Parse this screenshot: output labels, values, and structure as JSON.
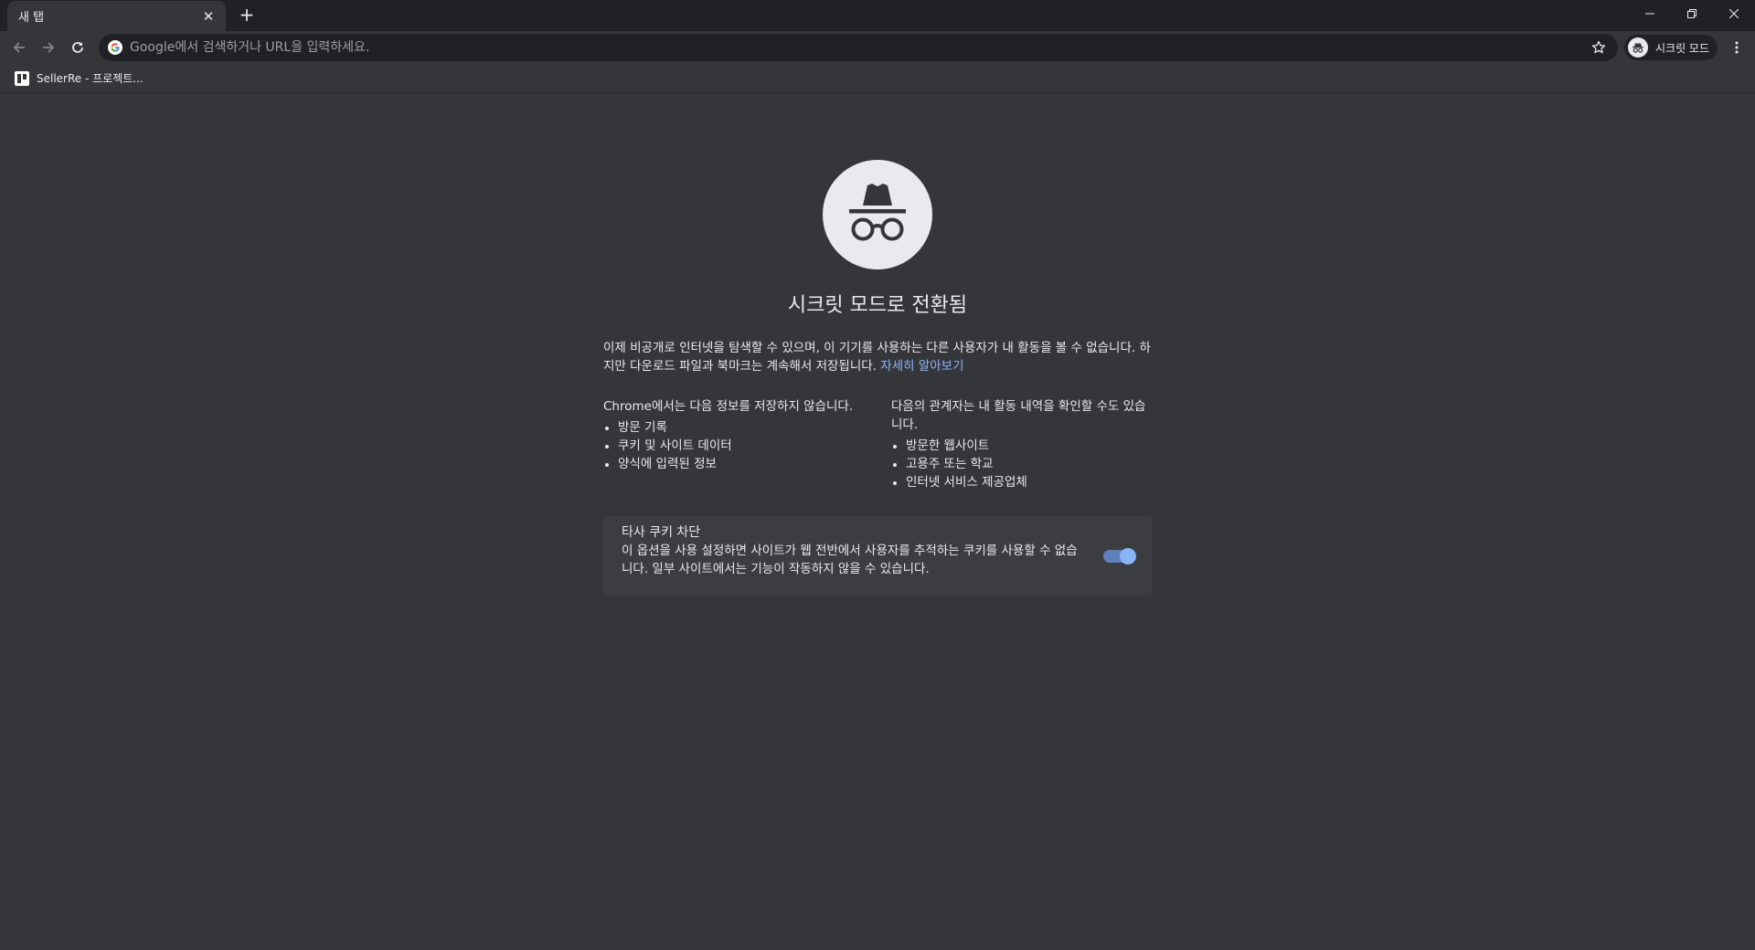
{
  "tab": {
    "title": "새 탭",
    "close_glyph": "✕"
  },
  "new_tab_glyph": "+",
  "omnibox": {
    "placeholder": "Google에서 검색하거나 URL을 입력하세요."
  },
  "profile": {
    "label": "시크릿 모드"
  },
  "bookmarks": [
    {
      "label": "SellerRe - 프로젝트..."
    }
  ],
  "content": {
    "title": "시크릿 모드로 전환됨",
    "intro": "이제 비공개로 인터넷을 탐색할 수 있으며, 이 기기를 사용하는 다른 사용자가 내 활동을 볼 수 없습니다. 하지만 다운로드 파일과 북마크는 계속해서 저장됩니다. ",
    "learn_more": "자세히 알아보기",
    "not_saved": {
      "heading": "Chrome에서는 다음 정보를 저장하지 않습니다.",
      "items": [
        "방문 기록",
        "쿠키 및 사이트 데이터",
        "양식에 입력된 정보"
      ]
    },
    "visible_to": {
      "heading": "다음의 관계자는 내 활동 내역을 확인할 수도 있습니다.",
      "items": [
        "방문한 웹사이트",
        "고용주 또는 학교",
        "인터넷 서비스 제공업체"
      ]
    },
    "cookie_card": {
      "title": "타사 쿠키 차단",
      "description": "이 옵션을 사용 설정하면 사이트가 웹 전반에서 사용자를 추적하는 쿠키를 사용할 수 없습니다. 일부 사이트에서는 기능이 작동하지 않을 수 있습니다.",
      "toggle_on": true
    }
  },
  "colors": {
    "background": "#35363a",
    "tabstrip": "#202124",
    "link": "#8ab4f8",
    "toggle_track": "#5e7fbd",
    "toggle_knob": "#8ab4f8"
  },
  "icons": [
    "back-arrow-icon",
    "forward-arrow-icon",
    "reload-icon",
    "google-g-icon",
    "star-icon",
    "incognito-icon",
    "more-vert-icon",
    "minimize-icon",
    "restore-icon",
    "close-icon"
  ]
}
